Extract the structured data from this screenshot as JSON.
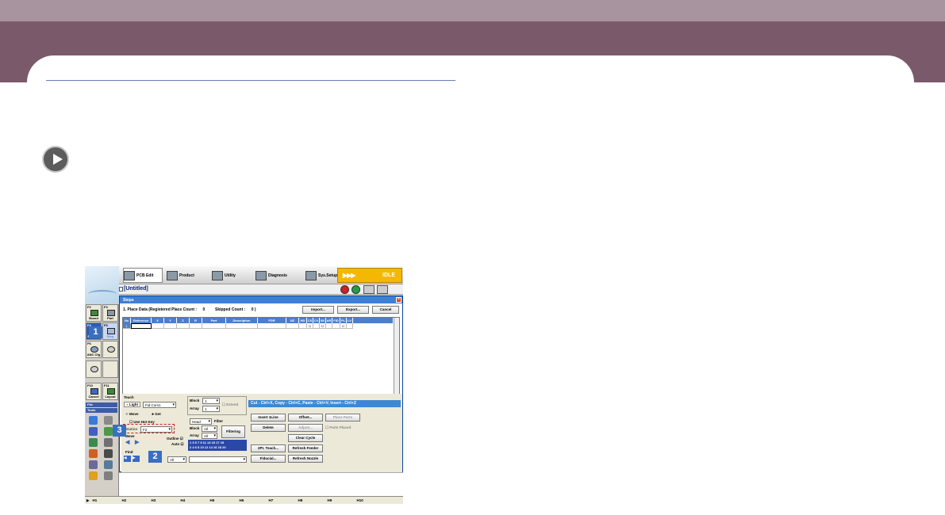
{
  "app": {
    "tabs": [
      "PCB Edit",
      "Product",
      "Utility",
      "Diagnosis",
      "Sys.Setup"
    ],
    "status": "IDLE",
    "status_arrows": "▶▶▶",
    "document_title": "[Untitled]"
  },
  "sidebar": {
    "fkeys": [
      {
        "key": "F2",
        "label": "Board"
      },
      {
        "key": "F3",
        "label": "Part"
      },
      {
        "key": "F4",
        "label": "Fiducial"
      },
      {
        "key": "F5",
        "label": "Step"
      },
      {
        "key": "F6",
        "label": "ANC Cfg"
      },
      {
        "key": "F10",
        "label": "Cancel"
      },
      {
        "key": "F11",
        "label": "Layout"
      }
    ],
    "file_header": "File",
    "tools_header": "Tools"
  },
  "dialog": {
    "title": "Steps",
    "place_data": "1. Place Data  (Registered Place Count :",
    "registered_count": "0",
    "skipped_label": "Skipped Count :",
    "skipped_count": "0 )",
    "import_label": "Import...",
    "export_label": "Export...",
    "cancel_label": "Cancel",
    "close_glyph": "×",
    "columns": [
      "No",
      "Reference",
      "X",
      "Y",
      "Z",
      "R",
      "Part",
      "Description",
      "FDR",
      "NZ",
      "HD",
      "CS",
      "CV",
      "SK",
      "AR",
      "FID",
      "PL",
      "LV"
    ],
    "row": [
      "1",
      "",
      "",
      "",
      "",
      "",
      "",
      "",
      "",
      "",
      "",
      "☐",
      "",
      "☐",
      "",
      "",
      "☐",
      ""
    ]
  },
  "teach": {
    "title": "Teach",
    "light_label": "Light",
    "light_value": "Fid Com1",
    "move_label": "Move",
    "get_label": "Get",
    "use_hot_key": "Use Hot Key",
    "station_label": "Station",
    "station_value": "F2",
    "move2_label": "Move",
    "outline_label": "Outline",
    "auto_label": "Auto",
    "find_label": "Find",
    "find_combo": "All"
  },
  "block_area": {
    "block_label": "Block",
    "block_value": "1",
    "array_label": "Array",
    "array_value": "1",
    "extend_label": "Extend",
    "head_label": "Head",
    "filter_label": "Filter",
    "block2_value": "All",
    "array2_value": "All",
    "filtering_label": "Filtering",
    "numbers_row1": "1 3 5 7 9 11 13 15 17 19",
    "numbers_row2": "2 4 6 8 10 12 14 16 18 20"
  },
  "tip": "Cut - Ctrl+X, Copy - Ctrl+C, Paste - Ctrl+V, Insert - Ctrl+Z",
  "actions": {
    "insert": "Insert 1Line",
    "offset": "Offset...",
    "place_parts": "Place Parts",
    "delete": "Delete",
    "adjust": "Adjust...",
    "parts_placed": "Parts Placed",
    "clear_cycle": "Clear Cycle",
    "teach2": "2Pt. Teach...",
    "refresh_feeder": "Refresh Feeder",
    "fiducial": "Fiducial...",
    "refresh_nozzle": "Refresh Nozzle"
  },
  "callouts": [
    "1",
    "2",
    "3"
  ],
  "statusbar": [
    "H1",
    "H2",
    "H3",
    "H4",
    "H5",
    "H6",
    "H7",
    "H8",
    "H9",
    "H10"
  ]
}
